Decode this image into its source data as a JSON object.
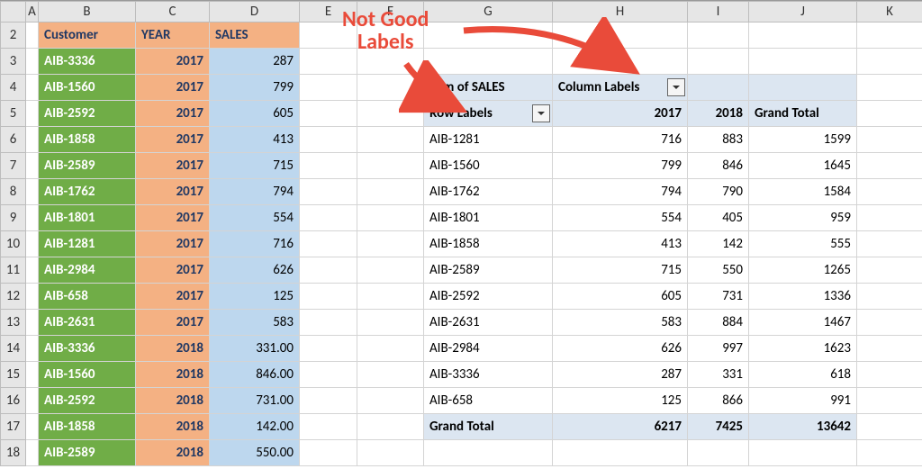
{
  "columns": [
    "",
    "A",
    "B",
    "C",
    "D",
    "E",
    "F",
    "G",
    "H",
    "I",
    "J",
    "K"
  ],
  "rowNumbers": [
    "2",
    "3",
    "4",
    "5",
    "6",
    "7",
    "8",
    "9",
    "10",
    "11",
    "12",
    "13",
    "14",
    "15",
    "16",
    "17",
    "18"
  ],
  "headers": {
    "customer": "Customer",
    "year": "YEAR",
    "sales": "SALES"
  },
  "data": [
    {
      "cust": "AIB-3336",
      "year": "2017",
      "sales": "287"
    },
    {
      "cust": "AIB-1560",
      "year": "2017",
      "sales": "799"
    },
    {
      "cust": "AIB-2592",
      "year": "2017",
      "sales": "605"
    },
    {
      "cust": "AIB-1858",
      "year": "2017",
      "sales": "413"
    },
    {
      "cust": "AIB-2589",
      "year": "2017",
      "sales": "715"
    },
    {
      "cust": "AIB-1762",
      "year": "2017",
      "sales": "794"
    },
    {
      "cust": "AIB-1801",
      "year": "2017",
      "sales": "554"
    },
    {
      "cust": "AIB-1281",
      "year": "2017",
      "sales": "716"
    },
    {
      "cust": "AIB-2984",
      "year": "2017",
      "sales": "626"
    },
    {
      "cust": "AIB-658",
      "year": "2017",
      "sales": "125"
    },
    {
      "cust": "AIB-2631",
      "year": "2017",
      "sales": "583"
    },
    {
      "cust": "AIB-3336",
      "year": "2018",
      "sales": "331.00"
    },
    {
      "cust": "AIB-1560",
      "year": "2018",
      "sales": "846.00"
    },
    {
      "cust": "AIB-2592",
      "year": "2018",
      "sales": "731.00"
    },
    {
      "cust": "AIB-1858",
      "year": "2018",
      "sales": "142.00"
    },
    {
      "cust": "AIB-2589",
      "year": "2018",
      "sales": "550.00"
    }
  ],
  "pivot": {
    "sumLabel": "Sum of SALES",
    "colLabels": "Column Labels",
    "rowLabels": "Row Labels",
    "y1": "2017",
    "y2": "2018",
    "gt": "Grand Total",
    "rows": [
      {
        "name": "AIB-1281",
        "v1": "716",
        "v2": "883",
        "gt": "1599"
      },
      {
        "name": "AIB-1560",
        "v1": "799",
        "v2": "846",
        "gt": "1645"
      },
      {
        "name": "AIB-1762",
        "v1": "794",
        "v2": "790",
        "gt": "1584"
      },
      {
        "name": "AIB-1801",
        "v1": "554",
        "v2": "405",
        "gt": "959"
      },
      {
        "name": "AIB-1858",
        "v1": "413",
        "v2": "142",
        "gt": "555"
      },
      {
        "name": "AIB-2589",
        "v1": "715",
        "v2": "550",
        "gt": "1265"
      },
      {
        "name": "AIB-2592",
        "v1": "605",
        "v2": "731",
        "gt": "1336"
      },
      {
        "name": "AIB-2631",
        "v1": "583",
        "v2": "884",
        "gt": "1467"
      },
      {
        "name": "AIB-2984",
        "v1": "626",
        "v2": "997",
        "gt": "1623"
      },
      {
        "name": "AIB-3336",
        "v1": "287",
        "v2": "331",
        "gt": "618"
      },
      {
        "name": "AIB-658",
        "v1": "125",
        "v2": "866",
        "gt": "991"
      }
    ],
    "total": {
      "name": "Grand Total",
      "v1": "6217",
      "v2": "7425",
      "gt": "13642"
    }
  },
  "callout": "Not Good\nLabels"
}
